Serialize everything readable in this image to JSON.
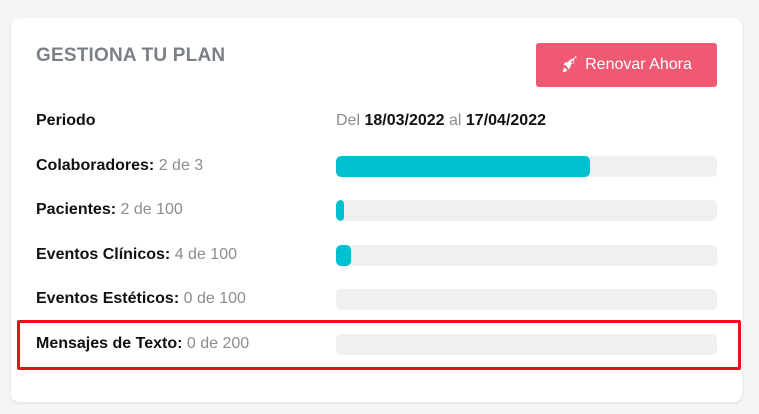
{
  "plan": {
    "title": "GESTIONA TU PLAN",
    "renew_button": {
      "label": "Renovar Ahora",
      "icon": "rocket-icon"
    },
    "period": {
      "label": "Periodo",
      "from_prefix": "Del",
      "from_date": "18/03/2022",
      "connector": "al",
      "to_date": "17/04/2022"
    },
    "usage": [
      {
        "label": "Colaboradores:",
        "count_text": "2 de 3",
        "used": 2,
        "total": 3
      },
      {
        "label": "Pacientes:",
        "count_text": "2 de 100",
        "used": 2,
        "total": 100
      },
      {
        "label": "Eventos Clínicos:",
        "count_text": "4 de 100",
        "used": 4,
        "total": 100
      },
      {
        "label": "Eventos Estéticos:",
        "count_text": "0 de 100",
        "used": 0,
        "total": 100
      },
      {
        "label": "Mensajes de Texto:",
        "count_text": "0 de 200",
        "used": 0,
        "total": 200
      }
    ]
  },
  "colors": {
    "accent_button": "#ef5a72",
    "progress_fill": "#00bfcf",
    "progress_track": "#f0f0f0",
    "highlight_border": "#e8111a"
  }
}
